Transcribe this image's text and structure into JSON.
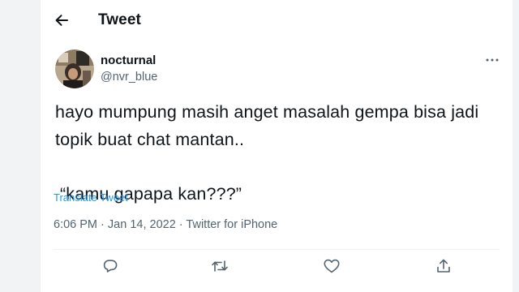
{
  "header": {
    "title": "Tweet",
    "back_icon": "arrow-left-icon"
  },
  "tweet": {
    "author": {
      "name": "nocturnal",
      "handle": "@nvr_blue",
      "avatar_icon": "avatar-photo"
    },
    "text_line1": "hayo mumpung masih anget masalah gempa bisa jadi",
    "text_line2": "topik buat chat mantan..",
    "quote": "“kamu gapapa kan???”",
    "translate_label": "Translate Tweet",
    "time": "6:06 PM",
    "date": "Jan 14, 2022",
    "source": "Twitter for iPhone",
    "separator": "·"
  },
  "actions": [
    {
      "name": "reply",
      "icon": "reply-icon"
    },
    {
      "name": "retweet",
      "icon": "retweet-icon"
    },
    {
      "name": "like",
      "icon": "heart-icon"
    },
    {
      "name": "share",
      "icon": "share-icon"
    }
  ],
  "colors": {
    "link": "#1d9bf0",
    "secondary_text": "#536471",
    "primary_text": "#0f1419",
    "divider": "#eff3f4"
  }
}
